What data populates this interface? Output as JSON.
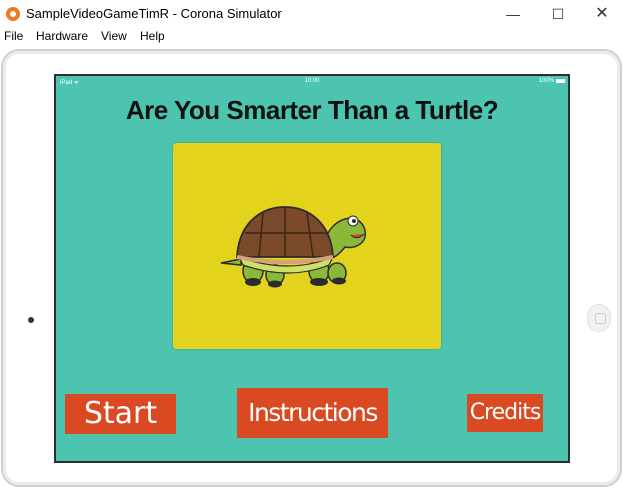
{
  "window": {
    "title": "SampleVideoGameTimR - Corona Simulator",
    "minimize_glyph": "—",
    "maximize_glyph": "☐",
    "close_glyph": "✕"
  },
  "menubar": {
    "items": [
      "File",
      "Hardware",
      "View",
      "Help"
    ]
  },
  "device": {
    "status_carrier": "iPad ᯤ",
    "status_time": "10:00",
    "status_battery": "100%"
  },
  "game": {
    "title": "Are You Smarter Than a Turtle?",
    "buttons": {
      "start": "Start",
      "instructions": "Instructions",
      "credits": "Credits"
    }
  },
  "colors": {
    "screen_bg": "#4cc4b0",
    "picture_bg": "#e4d31d",
    "button_bg": "#d94a23",
    "button_text": "#ffffff"
  },
  "icons": {
    "app_icon": "corona-simulator-icon",
    "picture": "turtle-illustration"
  }
}
